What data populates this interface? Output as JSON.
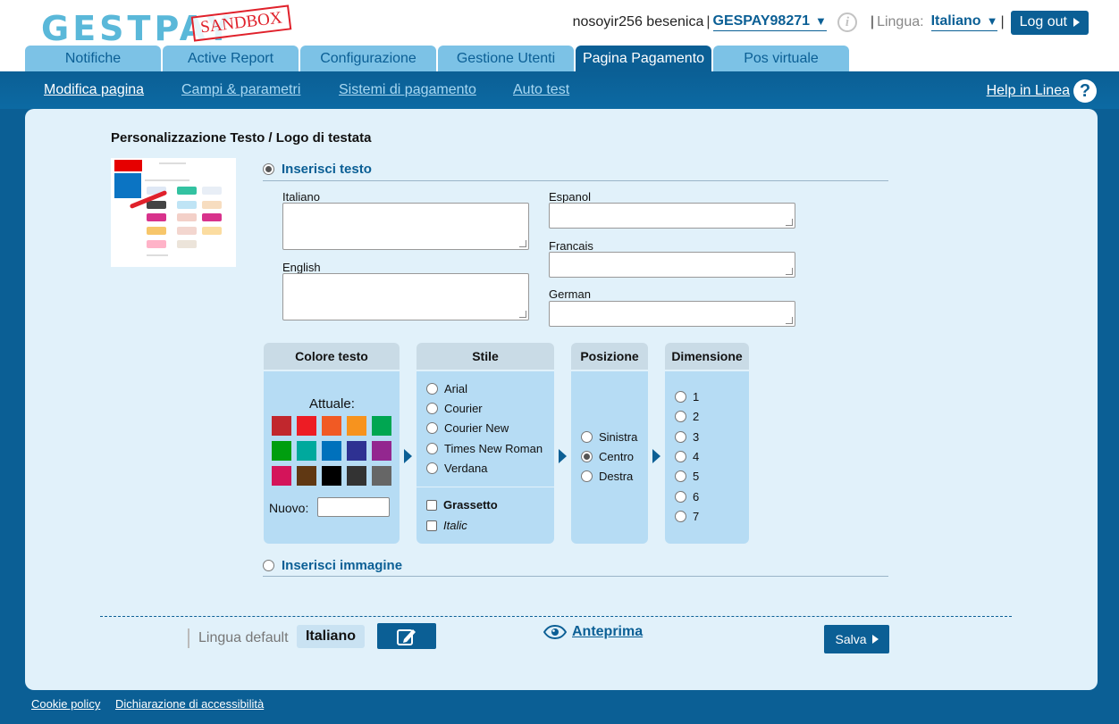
{
  "header": {
    "logo_text": "GESTPAY",
    "sandbox_label": "SANDBOX",
    "user_name": "nosoyir256 besenica",
    "merchant_code": "GESPAY98271",
    "lingua_label": "Lingua:",
    "lingua_value": "Italiano",
    "logout_label": "Log out"
  },
  "tabs": [
    {
      "label": "Notifiche"
    },
    {
      "label": "Active Report"
    },
    {
      "label": "Configurazione"
    },
    {
      "label": "Gestione Utenti"
    },
    {
      "label": "Pagina Pagamento"
    },
    {
      "label": "Pos virtuale"
    }
  ],
  "active_tab": "Pagina Pagamento",
  "subnav": {
    "items": [
      {
        "label": "Modifica pagina"
      },
      {
        "label": "Campi & parametri"
      },
      {
        "label": "Sistemi di pagamento"
      },
      {
        "label": "Auto test"
      }
    ],
    "help_label": "Help in Linea"
  },
  "panel": {
    "title": "Personalizzazione Testo / Logo di testata",
    "text_option": "Inserisci testo",
    "image_option": "Inserisci immagine",
    "languages": {
      "italiano": "Italiano",
      "english": "English",
      "espanol": "Espanol",
      "francais": "Francais",
      "german": "German"
    }
  },
  "options": {
    "colore_testo": {
      "header": "Colore testo",
      "attuale_label": "Attuale:",
      "nuovo_label": "Nuovo:",
      "swatches": [
        "#c1272d",
        "#ed1c24",
        "#f15a24",
        "#f7931e",
        "#00a651",
        "#009e0f",
        "#00a99d",
        "#0071bc",
        "#2e3192",
        "#93278f",
        "#d4145a",
        "#603813",
        "#000000",
        "#333333",
        "#666666"
      ]
    },
    "stile": {
      "header": "Stile",
      "fonts": [
        "Arial",
        "Courier",
        "Courier New",
        "Times New Roman",
        "Verdana"
      ],
      "grassetto": "Grassetto",
      "italic": "Italic"
    },
    "posizione": {
      "header": "Posizione",
      "items": [
        "Sinistra",
        "Centro",
        "Destra"
      ],
      "selected": "Centro"
    },
    "dimensione": {
      "header": "Dimensione",
      "items": [
        "1",
        "2",
        "3",
        "4",
        "5",
        "6",
        "7"
      ]
    }
  },
  "bottom": {
    "lingua_default_label": "Lingua default",
    "lingua_default_value": "Italiano",
    "anteprima_label": "Anteprima",
    "salva_label": "Salva"
  },
  "footer": {
    "cookie_policy": "Cookie policy",
    "accessibility": "Dichiarazione di accessibilità"
  }
}
